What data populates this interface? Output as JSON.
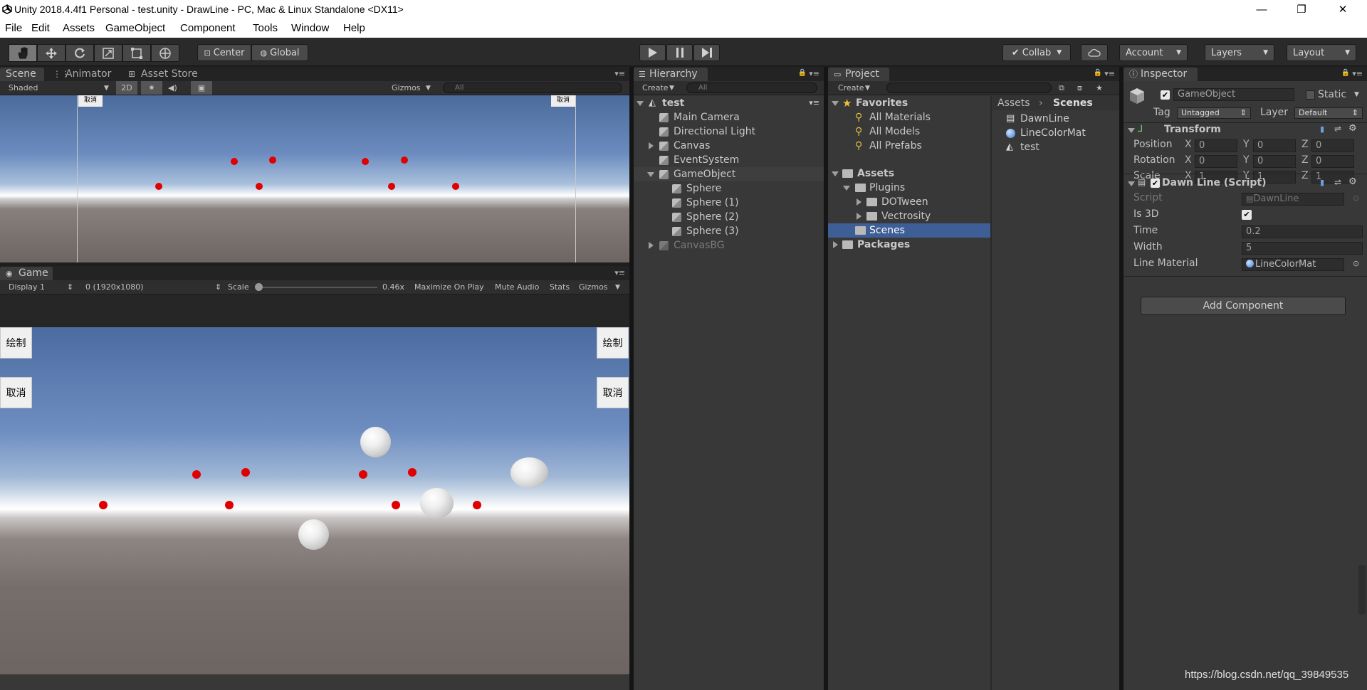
{
  "window": {
    "title": "Unity 2018.4.4f1 Personal - test.unity - DrawLine - PC, Mac & Linux Standalone <DX11>",
    "minimize": "—",
    "restore": "❐",
    "close": "✕"
  },
  "menu": [
    "File",
    "Edit",
    "Assets",
    "GameObject",
    "Component",
    "Tools",
    "Window",
    "Help"
  ],
  "toolbar": {
    "pivot": "Center",
    "space": "Global",
    "collab": "Collab",
    "account": "Account",
    "layers": "Layers",
    "layout": "Layout",
    "tools": [
      "hand-tool",
      "move-tool",
      "rotate-tool",
      "scale-tool",
      "rect-tool",
      "transform-tool"
    ]
  },
  "scene": {
    "tabs": [
      "Scene",
      "Animator",
      "Asset Store"
    ],
    "shading": "Shaded",
    "mode2d": "2D",
    "gizmos": "Gizmos",
    "search": "All",
    "cancel_label": "取消"
  },
  "game": {
    "tab": "Game",
    "display": "Display 1",
    "resolution": "0 (1920x1080)",
    "scale_label": "Scale",
    "scale_value": "0.46x",
    "maximize": "Maximize On Play",
    "mute": "Mute Audio",
    "stats": "Stats",
    "gizmos": "Gizmos",
    "draw_button": "绘制",
    "cancel_button": "取消",
    "scale_slider_fraction": 0
  },
  "hierarchy": {
    "tab": "Hierarchy",
    "create": "Create",
    "search": "All",
    "scene": "test",
    "items": [
      {
        "label": "Main Camera",
        "depth": 1,
        "expander": false
      },
      {
        "label": "Directional Light",
        "depth": 1,
        "expander": false
      },
      {
        "label": "Canvas",
        "depth": 1,
        "expander": true
      },
      {
        "label": "EventSystem",
        "depth": 1,
        "expander": false
      },
      {
        "label": "GameObject",
        "depth": 1,
        "expander": true,
        "open": true,
        "selected": true
      },
      {
        "label": "Sphere",
        "depth": 2,
        "expander": false
      },
      {
        "label": "Sphere (1)",
        "depth": 2,
        "expander": false
      },
      {
        "label": "Sphere (2)",
        "depth": 2,
        "expander": false
      },
      {
        "label": "Sphere (3)",
        "depth": 2,
        "expander": false
      },
      {
        "label": "CanvasBG",
        "depth": 1,
        "expander": true,
        "dim": true
      }
    ]
  },
  "project": {
    "tab": "Project",
    "create": "Create",
    "favorites": "Favorites",
    "fav_items": [
      "All Materials",
      "All Models",
      "All Prefabs"
    ],
    "assets": "Assets",
    "plugins": "Plugins",
    "dotween": "DOTween",
    "vectrosity": "Vectrosity",
    "scenes": "Scenes",
    "packages": "Packages",
    "breadcrumb_root": "Assets",
    "breadcrumb_sep": "›",
    "breadcrumb_leaf": "Scenes",
    "files": [
      "DawnLine",
      "LineColorMat",
      "test"
    ]
  },
  "inspector": {
    "tab": "Inspector",
    "object_name": "GameObject",
    "static": "Static",
    "tag_label": "Tag",
    "tag_value": "Untagged",
    "layer_label": "Layer",
    "layer_value": "Default",
    "transform": "Transform",
    "position": "Position",
    "rotation": "Rotation",
    "scale": "Scale",
    "x": "X",
    "y": "Y",
    "z": "Z",
    "pos": [
      "0",
      "0",
      "0"
    ],
    "rot": [
      "0",
      "0",
      "0"
    ],
    "scl": [
      "1",
      "1",
      "1"
    ],
    "script_component": "Dawn Line (Script)",
    "script_label": "Script",
    "script_value": "DawnLine",
    "is3d_label": "Is 3D",
    "time_label": "Time",
    "time_value": "0.2",
    "width_label": "Width",
    "width_value": "5",
    "material_label": "Line Material",
    "material_value": "LineColorMat",
    "add_component": "Add Component"
  },
  "watermark": "https://blog.csdn.net/qq_39849535"
}
